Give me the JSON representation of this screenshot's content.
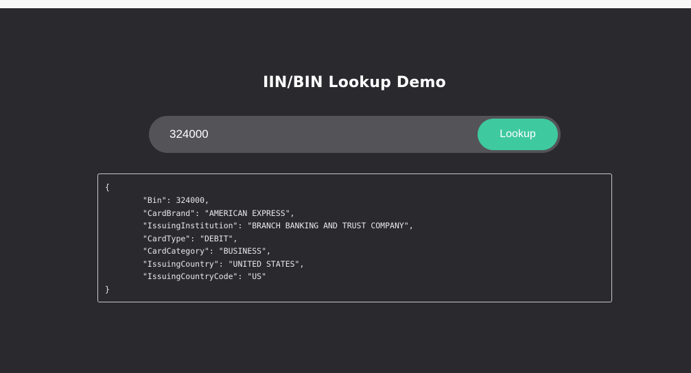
{
  "page": {
    "title": "IIN/BIN Lookup Demo"
  },
  "search": {
    "value": "324000",
    "button_label": "Lookup"
  },
  "result": {
    "lines": [
      "{",
      "\"Bin\": 324000,",
      "\"CardBrand\": \"AMERICAN EXPRESS\",",
      "\"IssuingInstitution\": \"BRANCH BANKING AND TRUST COMPANY\",",
      "\"CardType\": \"DEBIT\",",
      "\"CardCategory\": \"BUSINESS\",",
      "\"IssuingCountry\": \"UNITED STATES\",",
      "\"IssuingCountryCode\": \"US\"",
      "}"
    ]
  },
  "colors": {
    "background": "#2a292e",
    "search_bar": "#545358",
    "accent": "#3ec99e"
  }
}
